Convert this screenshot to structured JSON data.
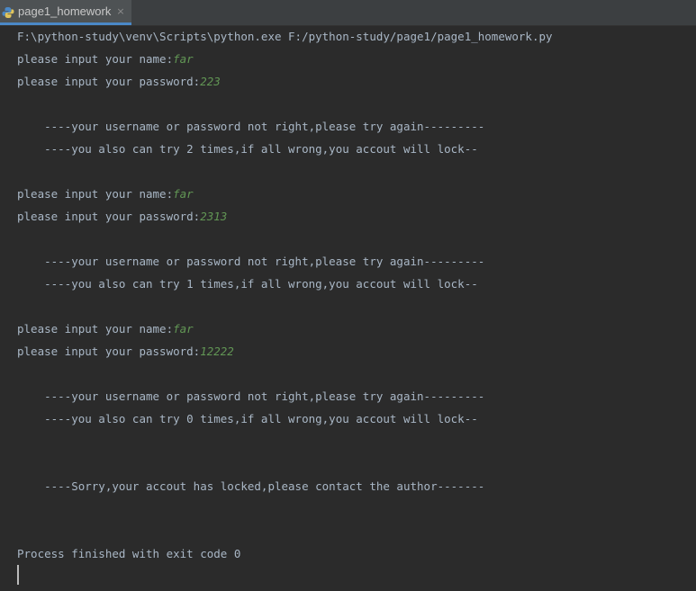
{
  "tab": {
    "label": "page1_homework",
    "close": "×"
  },
  "console": {
    "command": "F:\\python-study\\venv\\Scripts\\python.exe F:/python-study/page1/page1_homework.py",
    "attempts": [
      {
        "name_prompt": "please input your name:",
        "name_input": "far",
        "password_prompt": "please input your password:",
        "password_input": "223",
        "error": "    ----your username or password not right,please try again---------",
        "remaining": "    ----you also can try 2 times,if all wrong,you accout will lock--"
      },
      {
        "name_prompt": "please input your name:",
        "name_input": "far",
        "password_prompt": "please input your password:",
        "password_input": "2313",
        "error": "    ----your username or password not right,please try again---------",
        "remaining": "    ----you also can try 1 times,if all wrong,you accout will lock--"
      },
      {
        "name_prompt": "please input your name:",
        "name_input": "far",
        "password_prompt": "please input your password:",
        "password_input": "12222",
        "error": "    ----your username or password not right,please try again---------",
        "remaining": "    ----you also can try 0 times,if all wrong,you accout will lock--"
      }
    ],
    "locked": "    ----Sorry,your accout has locked,please contact the author-------",
    "exit": "Process finished with exit code 0"
  },
  "colors": {
    "background": "#2b2b2b",
    "text": "#a9b7c6",
    "user_input": "#629755",
    "tab_active": "#4e5254",
    "tab_underline": "#4a88c7"
  },
  "icons": {
    "tab_icon": "python-file-icon"
  }
}
